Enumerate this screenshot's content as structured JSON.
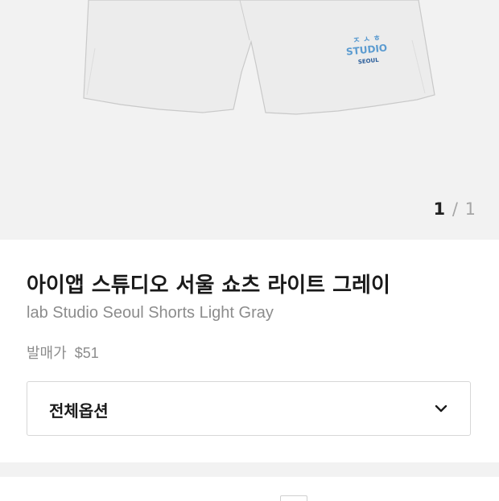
{
  "gallery": {
    "current": "1",
    "separator": "/",
    "total": "1",
    "print_lines": [
      "ㅈ ㅅ ㅎ",
      "STUDIO",
      "SEOUL"
    ],
    "shorts_color": "#ebebeb",
    "print_color": "#5b9bd0"
  },
  "product": {
    "name_ko": "아이앱 스튜디오 서울 쇼츠 라이트 그레이",
    "name_en": "lab Studio Seoul Shorts Light Gray",
    "price_label": "발매가",
    "price": "$51"
  },
  "option": {
    "label": "전체옵션",
    "icon": "chevron-down-icon"
  }
}
